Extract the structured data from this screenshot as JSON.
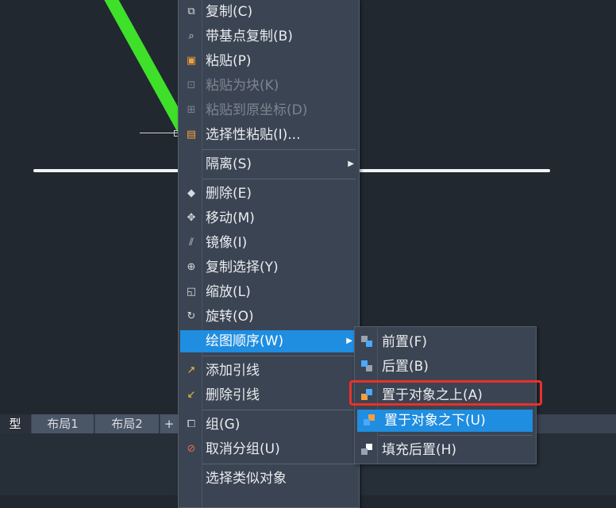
{
  "context_menu": {
    "items": [
      {
        "label": "复制(C)",
        "icon": "copy-icon",
        "disabled": false
      },
      {
        "label": "带基点复制(B)",
        "icon": "copy-basepoint-icon",
        "disabled": false
      },
      {
        "label": "粘贴(P)",
        "icon": "paste-icon",
        "disabled": false
      },
      {
        "label": "粘贴为块(K)",
        "icon": "paste-block-icon",
        "disabled": true
      },
      {
        "label": "粘贴到原坐标(D)",
        "icon": "paste-orig-coords-icon",
        "disabled": true
      },
      {
        "label": "选择性粘贴(I)...",
        "icon": "paste-special-icon",
        "disabled": false
      },
      {
        "label": "隔离(S)",
        "icon": "",
        "disabled": false,
        "submenu": true
      },
      {
        "label": "删除(E)",
        "icon": "eraser-icon",
        "disabled": false
      },
      {
        "label": "移动(M)",
        "icon": "move-icon",
        "disabled": false
      },
      {
        "label": "镜像(I)",
        "icon": "mirror-icon",
        "disabled": false
      },
      {
        "label": "复制选择(Y)",
        "icon": "copy-selection-icon",
        "disabled": false
      },
      {
        "label": "缩放(L)",
        "icon": "scale-icon",
        "disabled": false
      },
      {
        "label": "旋转(O)",
        "icon": "rotate-icon",
        "disabled": false
      },
      {
        "label": "绘图顺序(W)",
        "icon": "",
        "disabled": false,
        "submenu": true,
        "highlighted": true
      },
      {
        "label": "添加引线",
        "icon": "add-leader-icon",
        "disabled": false
      },
      {
        "label": "删除引线",
        "icon": "remove-leader-icon",
        "disabled": false
      },
      {
        "label": "组(G)",
        "icon": "group-icon",
        "disabled": false
      },
      {
        "label": "取消分组(U)",
        "icon": "ungroup-icon",
        "disabled": false
      },
      {
        "label": "选择类似对象",
        "icon": "",
        "disabled": false
      }
    ]
  },
  "draw_order_submenu": {
    "items": [
      {
        "label": "前置(F)",
        "icon": "bring-to-front-icon"
      },
      {
        "label": "后置(B)",
        "icon": "send-to-back-icon"
      },
      {
        "label": "置于对象之上(A)",
        "icon": "bring-above-objects-icon",
        "annotated": true
      },
      {
        "label": "置于对象之下(U)",
        "icon": "send-under-objects-icon",
        "highlighted": true
      },
      {
        "label": "填充后置(H)",
        "icon": "hatch-to-back-icon"
      }
    ]
  },
  "tabs": [
    {
      "label": "型",
      "active": true
    },
    {
      "label": "布局1",
      "active": false
    },
    {
      "label": "布局2",
      "active": false
    },
    {
      "label": "+",
      "active": false
    }
  ],
  "colors": {
    "accent": "#1f8de0",
    "annotation": "#e8312a",
    "green_line": "#3ee02a",
    "menu_bg": "#3b4452",
    "canvas_bg": "#212830"
  }
}
